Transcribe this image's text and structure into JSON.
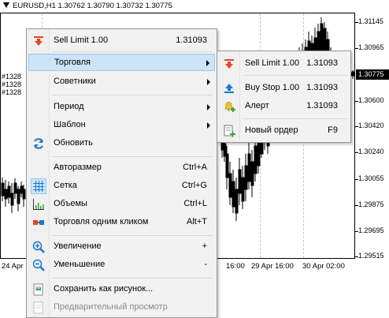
{
  "chart": {
    "symbol_title": "EURUSD,H1  1.30762 1.30790 1.30732 1.30775",
    "current_price": "1.30775",
    "price_labels": [
      "1.31145",
      "1.30965",
      "1.30600",
      "1.30420",
      "1.30240",
      "1.30055",
      "1.29875",
      "1.29695",
      "1.29515"
    ],
    "time_labels": [
      "24 Apr 16:00",
      "16:00",
      "29 Apr 16:00",
      "30 Apr 02:00"
    ],
    "order_tags": [
      "#1328",
      "#1328",
      "#1328"
    ]
  },
  "menu": {
    "items": [
      {
        "label": "Sell Limit 1.00",
        "shortcut": "1.31093",
        "icon": "sell-arrow-icon"
      },
      {
        "label": "Торговля",
        "submenu": true,
        "highlighted": true
      },
      {
        "label": "Советники",
        "submenu": true
      },
      {
        "label": "Период",
        "submenu": true
      },
      {
        "label": "Шаблон",
        "submenu": true
      },
      {
        "label": "Обновить",
        "icon": "refresh-icon"
      },
      {
        "label": "Авторазмер",
        "shortcut": "Ctrl+A"
      },
      {
        "label": "Сетка",
        "shortcut": "Ctrl+G",
        "icon": "grid-icon",
        "checked": true
      },
      {
        "label": "Объемы",
        "shortcut": "Ctrl+L",
        "icon": "volumes-icon"
      },
      {
        "label": "Торговля одним кликом",
        "shortcut": "Alt+T",
        "icon": "one-click-trading-icon"
      },
      {
        "label": "Увеличение",
        "shortcut": "+",
        "icon": "zoom-in-icon"
      },
      {
        "label": "Уменьшение",
        "shortcut": "-",
        "icon": "zoom-out-icon"
      },
      {
        "label": "Сохранить как рисунок...",
        "icon": "save-picture-icon"
      },
      {
        "label": "Предварительный просмотр",
        "disabled": true,
        "icon": "print-preview-icon"
      }
    ]
  },
  "submenu": {
    "items": [
      {
        "label": "Sell Limit 1.00",
        "shortcut": "1.31093",
        "icon": "sell-arrow-icon"
      },
      {
        "label": "Buy Stop 1.00",
        "shortcut": "1.31093",
        "icon": "buy-arrow-icon"
      },
      {
        "label": "Алерт",
        "shortcut": "1.31093",
        "icon": "alert-bell-icon"
      },
      {
        "label": "Новый ордер",
        "shortcut": "F9",
        "icon": "new-order-icon"
      }
    ]
  },
  "colors": {
    "sell": "#e8431e",
    "buy": "#1b78d0",
    "highlight": "#cce4f7",
    "green": "#3aa53a"
  }
}
